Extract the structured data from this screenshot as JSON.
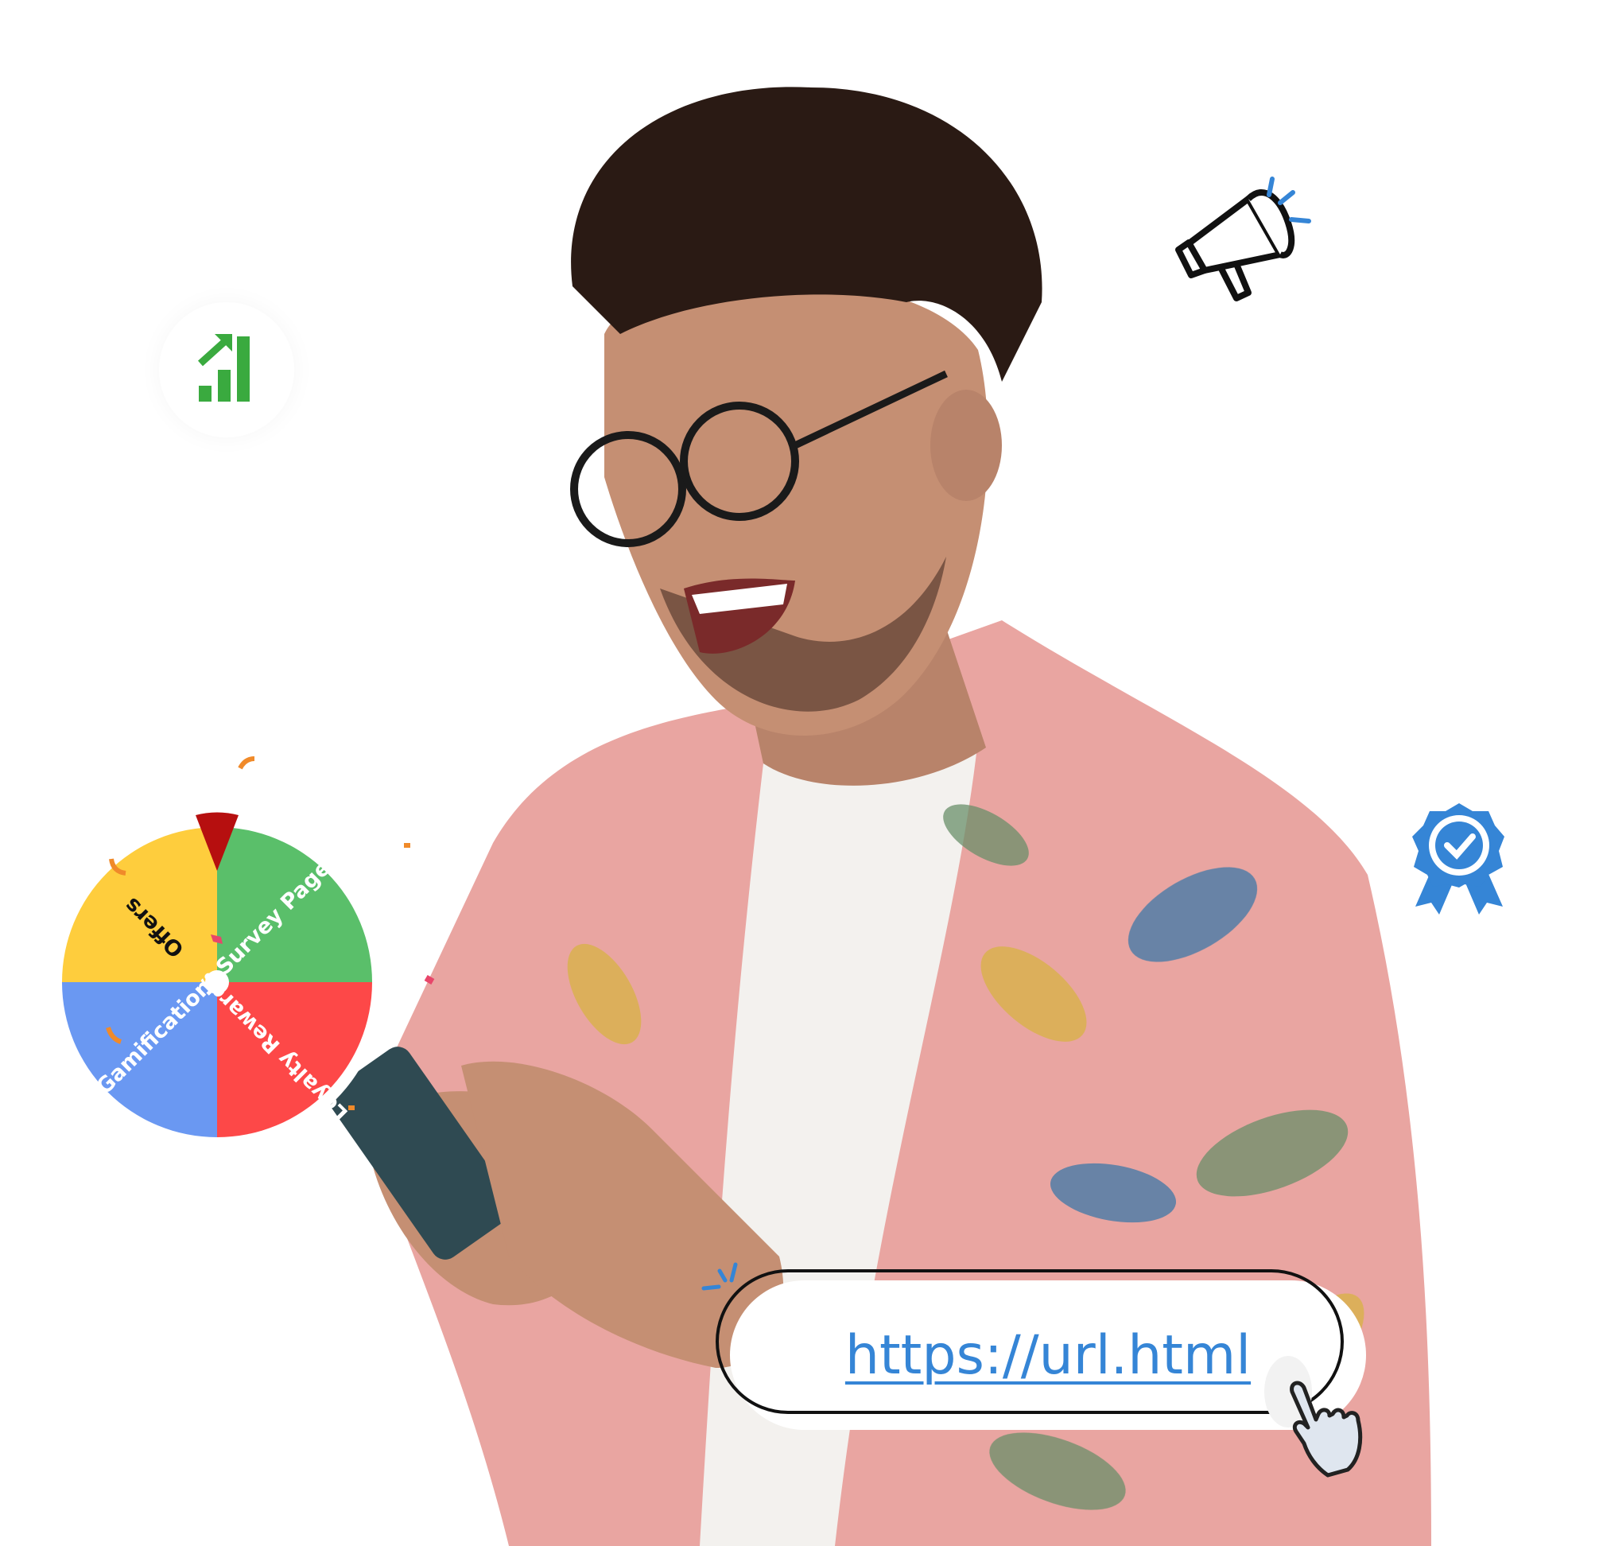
{
  "wheel": {
    "segments": [
      {
        "label": "Offers",
        "color": "#fecd3d",
        "text_color": "#111111"
      },
      {
        "label": "Survey Page",
        "color": "#5abf6a",
        "text_color": "#ffffff"
      },
      {
        "label": "Loyalty Rewards",
        "color": "#fd4848",
        "text_color": "#ffffff"
      },
      {
        "label": "Gamification",
        "color": "#6a98f2",
        "text_color": "#ffffff"
      }
    ],
    "pointer_color": "#b60f0f"
  },
  "link": {
    "text": "https://url.html",
    "color": "#3585d6"
  },
  "icons": [
    "growth-chart-icon",
    "megaphone-icon",
    "award-badge-icon",
    "pointing-hand-cursor-icon"
  ],
  "colors": {
    "chart_green": "#3aaa3f",
    "accent_blue": "#3585d6",
    "shirt_pink": "#e9a5a1"
  }
}
